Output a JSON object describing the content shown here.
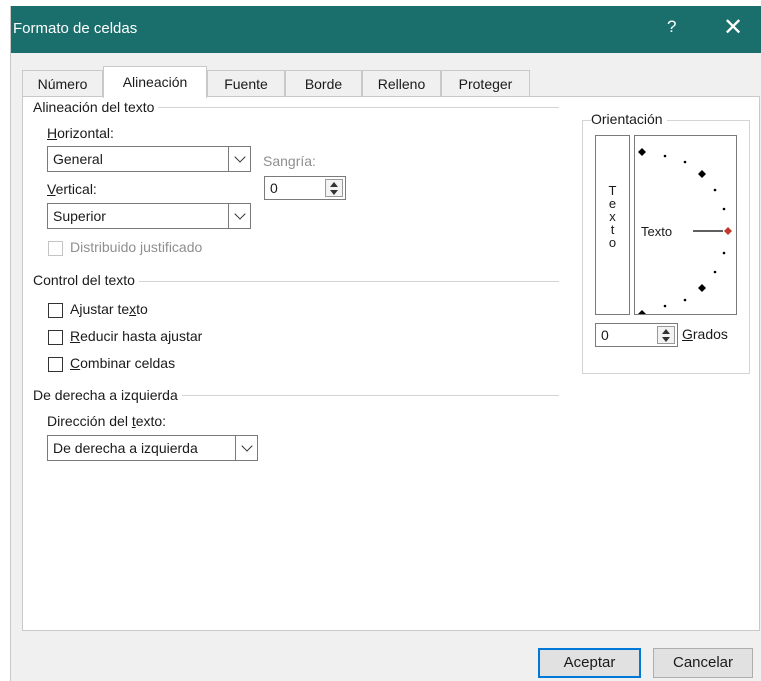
{
  "window": {
    "title": "Formato de celdas",
    "help_glyph": "?",
    "close_glyph": "✕"
  },
  "tabs": [
    {
      "label": "Número"
    },
    {
      "label": "Alineación",
      "active": true
    },
    {
      "label": "Fuente"
    },
    {
      "label": "Borde"
    },
    {
      "label": "Relleno"
    },
    {
      "label": "Proteger"
    }
  ],
  "text_alignment": {
    "group_label": "Alineación del texto",
    "horizontal_label": "Horizontal:",
    "horizontal_value": "General",
    "vertical_label": "Vertical:",
    "vertical_value": "Superior",
    "indent_label": "Sangría:",
    "indent_value": "0",
    "distributed_label": "Distribuido justificado"
  },
  "text_control": {
    "group_label": "Control del texto",
    "wrap_text": {
      "label": "Ajustar texto",
      "checked": false
    },
    "shrink_to_fit": {
      "label": "Reducir hasta ajustar",
      "checked": false
    },
    "merge_cells": {
      "label": "Combinar celdas",
      "checked": false
    }
  },
  "rtl": {
    "group_label": "De derecha a izquierda",
    "direction_label": "Dirección del texto:",
    "direction_value": "De derecha a izquierda"
  },
  "orientation": {
    "group_label": "Orientación",
    "vertical_text": "Texto",
    "dial_text": "Texto",
    "degrees_value": "0",
    "degrees_label": "Grados",
    "marker_color": "#c0392b"
  },
  "buttons": {
    "ok": "Aceptar",
    "cancel": "Cancelar"
  },
  "colors": {
    "titlebar": "#1a6e6c",
    "default_button_border": "#0078d7"
  }
}
